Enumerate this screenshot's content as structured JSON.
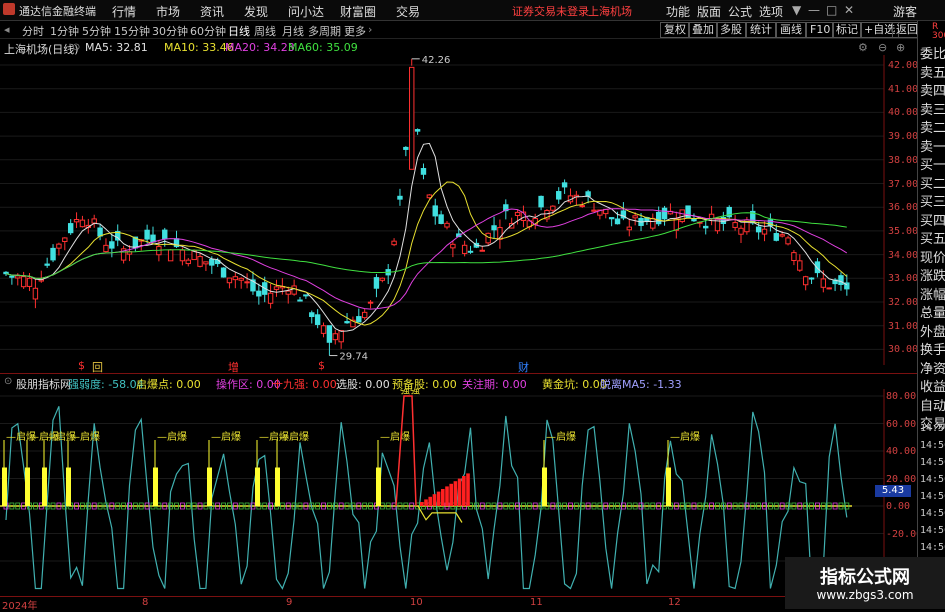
{
  "app": {
    "title": "通达信金融终端",
    "menu": [
      "行情",
      "市场",
      "资讯",
      "发现",
      "问小达",
      "财富圈",
      "交易"
    ],
    "notice": "证券交易未登录",
    "market_label": "上海机场",
    "right_menu": [
      "功能",
      "版面",
      "公式",
      "选项"
    ],
    "user": "游客",
    "window_buttons": [
      "▼",
      "—",
      "□",
      "✕"
    ]
  },
  "periods": [
    "分时",
    "1分钟",
    "5分钟",
    "15分钟",
    "30分钟",
    "60分钟",
    "日线",
    "周线",
    "月线",
    "多周期",
    "更多"
  ],
  "active_period": "日线",
  "tools": [
    "复权",
    "叠加",
    "多股",
    "统计",
    "画线",
    "F10",
    "标记",
    "+自选",
    "返回"
  ],
  "main": {
    "stock": "上海机场(日线)",
    "ma": [
      {
        "label": "MA5: 32.81",
        "color": "#e0e0e0"
      },
      {
        "label": "MA10: 33.46",
        "color": "#e8e030"
      },
      {
        "label": "MA20: 34.23",
        "color": "#e040e0"
      },
      {
        "label": "MA60: 35.09",
        "color": "#40e040"
      }
    ],
    "high_label": "42.26",
    "low_label": "29.74",
    "yticks": [
      "42.00",
      "41.00",
      "40.00",
      "39.00",
      "38.00",
      "37.00",
      "36.00",
      "35.00",
      "34.00",
      "33.00",
      "32.00",
      "31.00",
      "30.00"
    ],
    "markers": [
      {
        "text": "$",
        "color": "#ff3030"
      },
      {
        "text": "回",
        "color": "#e0c040"
      },
      {
        "text": "增",
        "color": "#ff3030"
      },
      {
        "text": "$",
        "color": "#ff3030"
      },
      {
        "text": "财",
        "color": "#3080ff"
      }
    ]
  },
  "indicator": {
    "name": "股朋指标网",
    "items": [
      {
        "label": "强弱度: -58.04",
        "color": "#40c0c0"
      },
      {
        "label": "启爆点: 0.00",
        "color": "#e8e030"
      },
      {
        "label": "操作区: 0.00",
        "color": "#e040e0"
      },
      {
        "label": "十九强: 0.00",
        "color": "#ff3030"
      },
      {
        "label": "选股: 0.00",
        "color": "#e0e0e0"
      },
      {
        "label": "预备股: 0.00",
        "color": "#e8e030"
      },
      {
        "label": "关注期: 0.00",
        "color": "#e040e0"
      },
      {
        "label": "黄金坑: 0.00",
        "color": "#e8e030"
      },
      {
        "label": "脱离MA5: -1.33",
        "color": "#a0a0ff"
      }
    ],
    "signal_label": "启爆",
    "peak_label": "强强",
    "yticks": [
      "80.00",
      "60.00",
      "40.00",
      "20.00",
      "0.00",
      "-20.00",
      "-40.00"
    ],
    "value_badge": "5.43"
  },
  "right_panel": [
    "R",
    "300",
    "委比",
    "卖五",
    "卖四",
    "卖三",
    "卖二",
    "卖一",
    "买一",
    "买二",
    "买三",
    "买四",
    "买五",
    "现价",
    "涨跌",
    "涨幅",
    "总量",
    "外盘",
    "换手",
    "净资",
    "收益",
    "自动",
    "交易"
  ],
  "times": [
    "14:56",
    "14:56",
    "14:56",
    "14:56",
    "14:56",
    "14:56",
    "14:56",
    "14:56"
  ],
  "xaxis": [
    "2024年",
    "8",
    "9",
    "10",
    "11",
    "12"
  ],
  "watermark": {
    "line1": "指标公式网",
    "line2": "www.zbgs3.com"
  },
  "colors": {
    "up": "#ff3030",
    "down": "#40e0e0",
    "ma5": "#e0e0e0",
    "ma10": "#e8e030",
    "ma20": "#e040e0",
    "ma60": "#40e040",
    "osc": "#40b0b0"
  }
}
